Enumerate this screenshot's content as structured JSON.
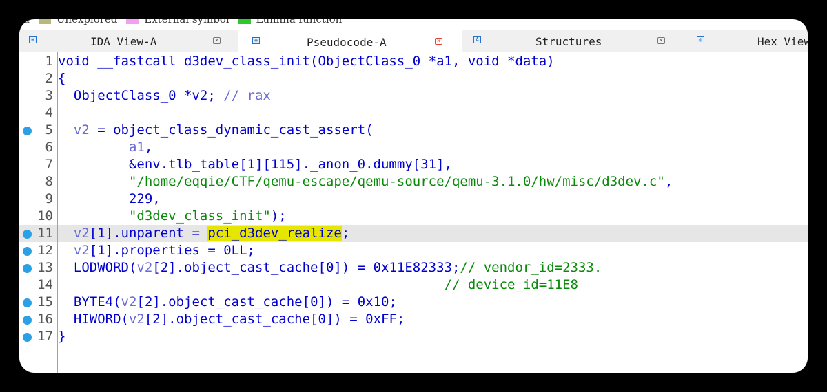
{
  "legend": {
    "items": [
      {
        "label": "Unexplored",
        "color": "#b8b87a"
      },
      {
        "label": "External symbol",
        "color": "#f2a0f2"
      },
      {
        "label": "Lumina function",
        "color": "#2ec82e"
      }
    ],
    "lead_text": "ta"
  },
  "tabs": [
    {
      "label": "IDA View-A",
      "close": "×",
      "icon": "ida-view-icon",
      "icon_glyph": "≡",
      "active": false
    },
    {
      "label": "Pseudocode-A",
      "close": "×",
      "icon": "pseudocode-icon",
      "icon_glyph": "≡",
      "active": true
    },
    {
      "label": "Structures",
      "close": "×",
      "icon": "structures-icon",
      "icon_glyph": "A",
      "active": false
    },
    {
      "label": "Hex View",
      "icon": "hex-view-icon",
      "icon_glyph": "◎",
      "active": false
    }
  ],
  "code": {
    "line_numbers": [
      "1",
      "2",
      "3",
      "4",
      "5",
      "6",
      "7",
      "8",
      "9",
      "10",
      "11",
      "12",
      "13",
      "14",
      "15",
      "16",
      "17"
    ],
    "breakpoint_lines": [
      5,
      11,
      12,
      13,
      15,
      16,
      17
    ],
    "highlight_line": 11,
    "lines": [
      [
        {
          "t": "void __fastcall d3dev_class_init(ObjectClass_0 *a1, void *data)"
        }
      ],
      [
        {
          "t": "{"
        }
      ],
      [
        {
          "t": "  ObjectClass_0 *v2; "
        },
        {
          "t": "// ",
          "c": "cmt2"
        },
        {
          "t": "rax",
          "c": "var"
        }
      ],
      [
        {
          "t": ""
        }
      ],
      [
        {
          "t": "  "
        },
        {
          "t": "v2",
          "c": "var"
        },
        {
          "t": " = object_class_dynamic_cast_assert("
        }
      ],
      [
        {
          "t": "         "
        },
        {
          "t": "a1",
          "c": "var"
        },
        {
          "t": ","
        }
      ],
      [
        {
          "t": "         &env.tlb_table[1][115]._anon_0.dummy[31],"
        }
      ],
      [
        {
          "t": "         "
        },
        {
          "t": "\"/home/eqqie/CTF/qemu-escape/qemu-source/qemu-3.1.0/hw/misc/d3dev.c\"",
          "c": "str"
        },
        {
          "t": ","
        }
      ],
      [
        {
          "t": "         229,"
        }
      ],
      [
        {
          "t": "         "
        },
        {
          "t": "\"d3dev_class_init\"",
          "c": "str"
        },
        {
          "t": ");"
        }
      ],
      [
        {
          "t": "  "
        },
        {
          "t": "v2",
          "c": "var"
        },
        {
          "t": "[1].unparent = "
        },
        {
          "t": "pci_d3dev_realize",
          "c": "sel"
        },
        {
          "t": ";"
        }
      ],
      [
        {
          "t": "  "
        },
        {
          "t": "v2",
          "c": "var"
        },
        {
          "t": "[1].properties = 0LL;"
        }
      ],
      [
        {
          "t": "  LODWORD("
        },
        {
          "t": "v2",
          "c": "var"
        },
        {
          "t": "[2].object_cast_cache[0]) = 0x11E82333;"
        },
        {
          "t": "// vendor_id=2333.",
          "c": "cmt"
        }
      ],
      [
        {
          "t": "                                                 "
        },
        {
          "t": "// device_id=11E8",
          "c": "cmt"
        }
      ],
      [
        {
          "t": "  BYTE4("
        },
        {
          "t": "v2",
          "c": "var"
        },
        {
          "t": "[2].object_cast_cache[0]) = 0x10;"
        }
      ],
      [
        {
          "t": "  HIWORD("
        },
        {
          "t": "v2",
          "c": "var"
        },
        {
          "t": "[2].object_cast_cache[0]) = 0xFF;"
        }
      ],
      [
        {
          "t": "}"
        }
      ]
    ]
  }
}
